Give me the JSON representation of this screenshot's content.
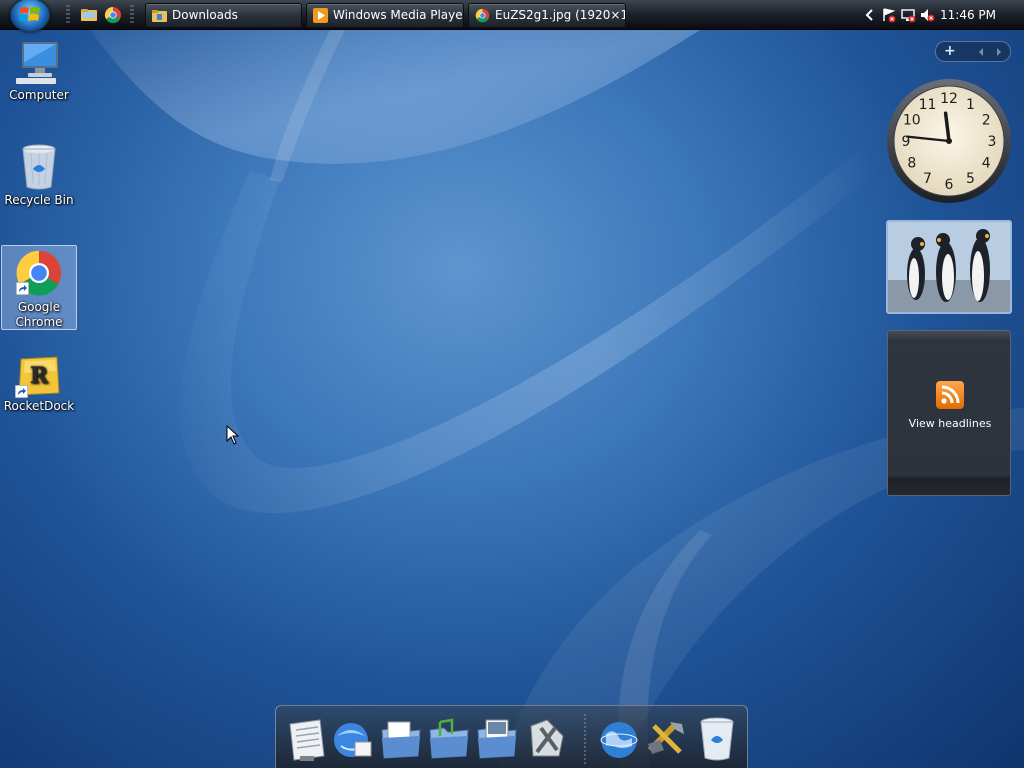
{
  "taskbar": {
    "tasks": [
      {
        "label": "Downloads",
        "icon": "folder-icon"
      },
      {
        "label": "Windows Media Player",
        "icon": "media-player-icon"
      },
      {
        "label": "EuZS2g1.jpg (1920×1...",
        "icon": "chrome-icon"
      }
    ],
    "quick_launch": [
      "show-desktop-icon",
      "explorer-icon",
      "chrome-icon"
    ],
    "clock": "11:46 PM"
  },
  "desktop_icons": [
    {
      "label": "Computer",
      "icon": "computer-icon"
    },
    {
      "label": "Recycle Bin",
      "icon": "recycle-bin-icon"
    },
    {
      "label": "Google Chrome",
      "icon": "chrome-icon",
      "selected": true
    },
    {
      "label": "RocketDock",
      "icon": "rocketdock-icon"
    }
  ],
  "gadgets": {
    "sidebar_add": "+",
    "clock_numbers": [
      "12",
      "1",
      "2",
      "3",
      "4",
      "5",
      "6",
      "7",
      "8",
      "9",
      "10",
      "11"
    ],
    "clock_time": {
      "hour": 11,
      "minute": 46
    },
    "feed_label": "View headlines"
  },
  "dock_items": [
    "notepad-icon",
    "internet-explorer-icon",
    "documents-folder-icon",
    "music-folder-icon",
    "pictures-folder-icon",
    "tools-icon",
    "network-globe-icon",
    "control-panel-icon",
    "recycle-bin-icon"
  ],
  "colors": {
    "desktop_base": "#1f5398",
    "taskbar": "#1b2129",
    "accent_orange": "#f57c00"
  }
}
